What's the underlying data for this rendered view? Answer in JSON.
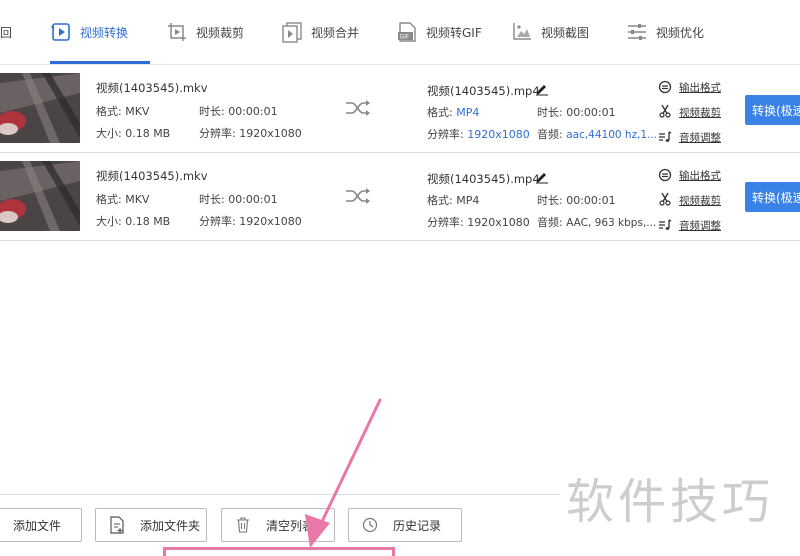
{
  "tabs": [
    {
      "label": "回",
      "icon": "partial-tab"
    },
    {
      "label": "视频转换",
      "icon": "video-convert-icon",
      "active": true
    },
    {
      "label": "视频裁剪",
      "icon": "video-crop-icon"
    },
    {
      "label": "视频合并",
      "icon": "video-merge-icon"
    },
    {
      "label": "视频转GIF",
      "icon": "gif-icon"
    },
    {
      "label": "视频截图",
      "icon": "screenshot-icon"
    },
    {
      "label": "视频优化",
      "icon": "optimize-icon"
    }
  ],
  "files": [
    {
      "source": {
        "name": "视频(1403545).mkv",
        "format_label": "格式: MKV",
        "duration_label": "时长: 00:00:01",
        "size_label": "大小: 0.18 MB",
        "resolution_label": "分辨率: 1920x1080"
      },
      "output": {
        "name": "视频(1403545).mp4",
        "format_prefix": "格式: ",
        "format": "MP4",
        "duration_label": "时长: 00:00:01",
        "resolution_prefix": "分辨率: ",
        "resolution": "1920x1080",
        "audio_prefix": "音频: ",
        "audio": "aac,44100 hz,1..."
      },
      "highlighted": true
    },
    {
      "source": {
        "name": "视频(1403545).mkv",
        "format_label": "格式: MKV",
        "duration_label": "时长: 00:00:01",
        "size_label": "大小: 0.18 MB",
        "resolution_label": "分辨率: 1920x1080"
      },
      "output": {
        "name": "视频(1403545).mp4",
        "format_prefix": "格式: ",
        "format": "MP4",
        "duration_label": "时长: 00:00:01",
        "resolution_prefix": "分辨率: ",
        "resolution": "1920x1080",
        "audio_prefix": "音频: ",
        "audio": "AAC, 963 kbps,..."
      },
      "highlighted": false
    }
  ],
  "row_links": {
    "output_format": "输出格式",
    "video_crop": "视频裁剪",
    "audio_adjust": "音频调整"
  },
  "convert_button": "转换(极速",
  "bottom_buttons": {
    "add_file": "添加文件",
    "add_folder": "添加文件夹",
    "clear_list": "清空列表",
    "history": "历史记录"
  },
  "watermark": "软件技巧",
  "colors": {
    "accent": "#2d6fd6",
    "convert_button": "#3b82e6",
    "annotation": "#e879a6"
  }
}
